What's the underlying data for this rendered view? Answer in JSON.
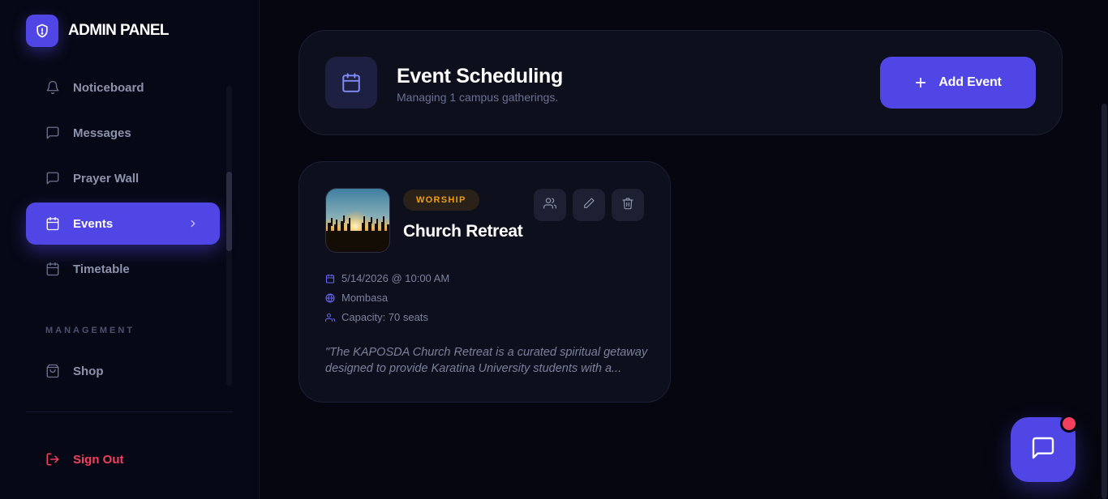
{
  "brand": {
    "name": "ADMIN PANEL",
    "logo_icon": "shield-icon"
  },
  "sidebar": {
    "items": [
      {
        "label": "Noticeboard",
        "icon": "bell-icon",
        "active": false
      },
      {
        "label": "Messages",
        "icon": "message-icon",
        "active": false
      },
      {
        "label": "Prayer Wall",
        "icon": "message-icon",
        "active": false
      },
      {
        "label": "Events",
        "icon": "calendar-icon",
        "active": true
      },
      {
        "label": "Timetable",
        "icon": "calendar-icon",
        "active": false
      }
    ],
    "section_label": "MANAGEMENT",
    "management_items": [
      {
        "label": "Shop",
        "icon": "shopping-bag-icon"
      }
    ],
    "signout_label": "Sign Out"
  },
  "header": {
    "title": "Event Scheduling",
    "subtitle": "Managing 1 campus gatherings.",
    "add_button_label": "Add Event"
  },
  "event": {
    "category": "WORSHIP",
    "title": "Church Retreat",
    "datetime": "5/14/2026 @ 10:00 AM",
    "location": "Mombasa",
    "capacity": "Capacity: 70 seats",
    "description": "\"The KAPOSDA Church Retreat is a curated spiritual getaway designed to provide Karatina University students with a..."
  },
  "colors": {
    "accent": "#4f46e5",
    "danger": "#f43f5e",
    "badge": "#f59e0b",
    "background": "#05060f"
  }
}
